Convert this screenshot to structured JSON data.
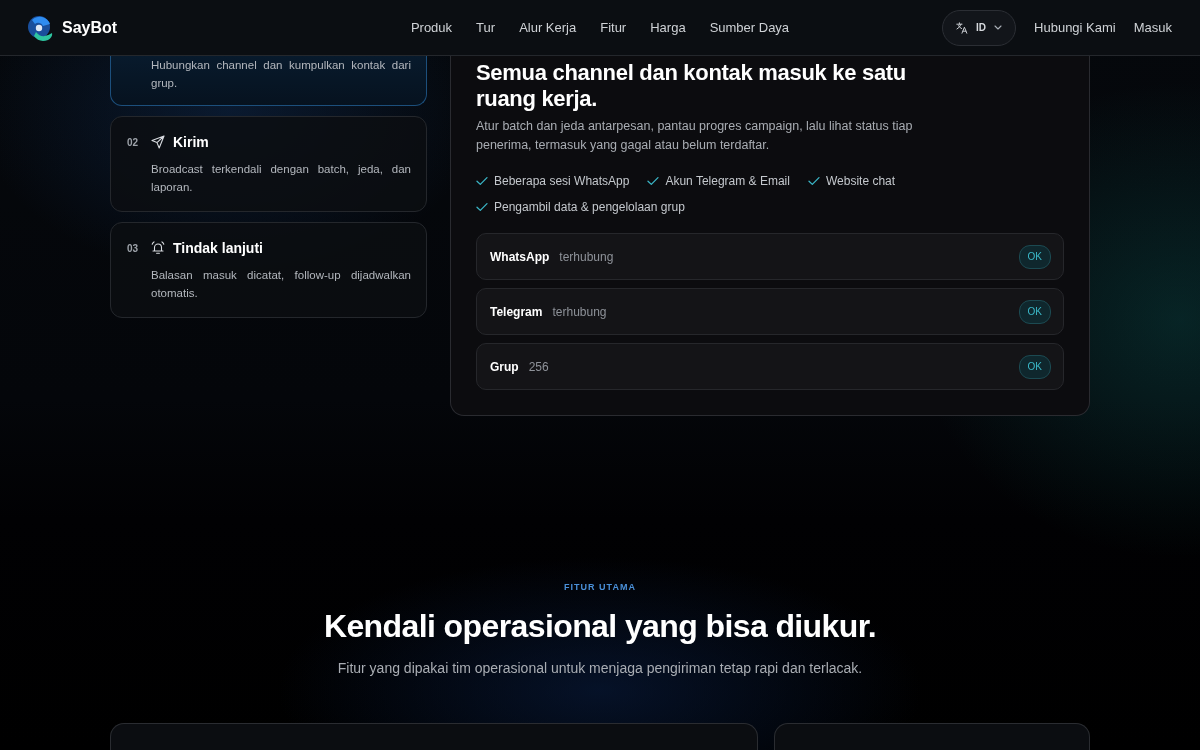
{
  "header": {
    "brand": "SayBot",
    "nav": [
      "Produk",
      "Tur",
      "Alur Kerja",
      "Fitur",
      "Harga",
      "Sumber Daya"
    ],
    "language": "ID",
    "links": [
      "Hubungi Kami",
      "Masuk"
    ]
  },
  "steps": [
    {
      "description": "Hubungkan channel dan kumpulkan kontak dari grup.",
      "selected": true
    },
    {
      "number": "02",
      "title": "Kirim",
      "description": "Broadcast terkendali dengan batch, jeda, dan laporan.",
      "selected": false
    },
    {
      "number": "03",
      "title": "Tindak lanjuti",
      "description": "Balasan masuk dicatat, follow-up dijadwalkan otomatis.",
      "selected": false
    }
  ],
  "stage_panel": {
    "title": "Semua channel dan kontak masuk ke satu ruang kerja.",
    "description": "Atur batch dan jeda antarpesan, pantau progres campaign, lalu lihat status tiap penerima, termasuk yang gagal atau belum terdaftar.",
    "checklist": [
      "Beberapa sesi WhatsApp",
      "Akun Telegram & Email",
      "Website chat",
      "Pengambil data & pengelolaan grup"
    ],
    "channels": [
      {
        "name": "WhatsApp",
        "detail": "terhubung",
        "badge": "OK"
      },
      {
        "name": "Telegram",
        "detail": "terhubung",
        "badge": "OK"
      },
      {
        "name": "Grup",
        "detail": "256",
        "badge": "OK"
      }
    ]
  },
  "features": {
    "eyebrow": "FITUR UTAMA",
    "title": "Kendali operasional yang bisa diukur.",
    "subtitle": "Fitur yang dipakai tim operasional untuk menjaga pengiriman tetap rapi dan terlacak."
  }
}
